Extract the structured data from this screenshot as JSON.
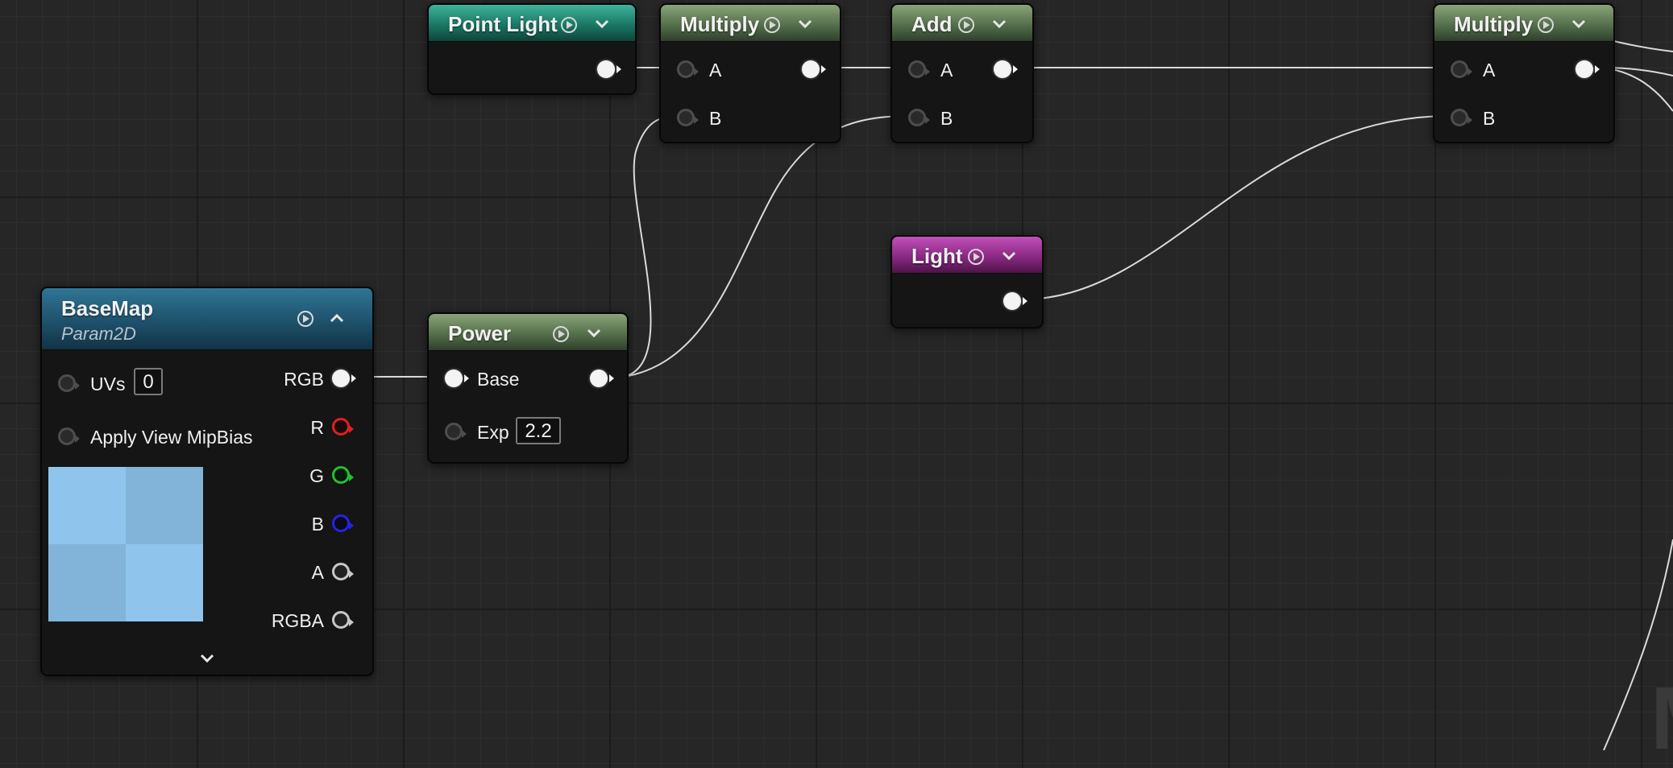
{
  "nodes": {
    "point_light": {
      "title": "Point Light"
    },
    "multiply1": {
      "title": "Multiply",
      "pin_a": "A",
      "pin_b": "B"
    },
    "add": {
      "title": "Add",
      "pin_a": "A",
      "pin_b": "B"
    },
    "multiply2": {
      "title": "Multiply",
      "pin_a": "A",
      "pin_b": "B"
    },
    "light": {
      "title": "Light"
    },
    "power": {
      "title": "Power",
      "pin_base": "Base",
      "pin_exp": "Exp",
      "exp_value": "2.2"
    },
    "basemap": {
      "title": "BaseMap",
      "subtitle": "Param2D",
      "uvs_label": "UVs",
      "uvs_value": "0",
      "mipbias_label": "Apply View MipBias",
      "outputs": [
        "RGB",
        "R",
        "G",
        "B",
        "A",
        "RGBA"
      ]
    }
  },
  "colors": {
    "header_green": "#55704c",
    "header_teal": "#1a7865",
    "header_magenta": "#8a2a83",
    "header_blue": "#1d4e67",
    "pin_red": "#e02020",
    "pin_green": "#22c02a",
    "pin_blue": "#2424e0",
    "preview_light": "#8fc4ec",
    "preview_dark": "#82b4da"
  },
  "icons": [
    "play-icon",
    "chevron-down-icon",
    "chevron-up-icon"
  ]
}
